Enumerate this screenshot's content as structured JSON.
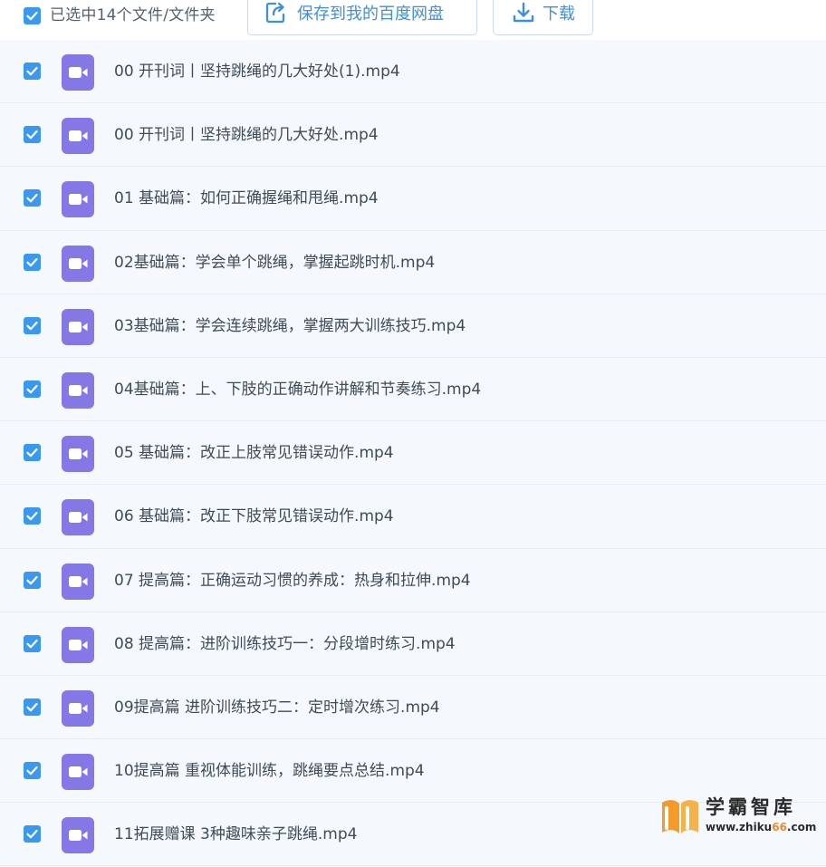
{
  "toolbar": {
    "selection_text": "已选中14个文件/文件夹",
    "save_label": "保存到我的百度网盘",
    "download_label": "下载"
  },
  "colors": {
    "accent": "#3b98f0",
    "row_background": "#f5f9fd",
    "video_icon": "#8378e6",
    "watermark_orange": "#f0892a"
  },
  "icons": {
    "checkbox": "check-icon",
    "file": "video-file-icon",
    "save": "save-to-cloud-icon",
    "download": "download-icon"
  },
  "files": [
    {
      "name": "00 开刊词丨坚持跳绳的几大好处(1).mp4",
      "checked": true
    },
    {
      "name": "00 开刊词丨坚持跳绳的几大好处.mp4",
      "checked": true
    },
    {
      "name": "01 基础篇：如何正确握绳和甩绳.mp4",
      "checked": true
    },
    {
      "name": "02基础篇：学会单个跳绳，掌握起跳时机.mp4",
      "checked": true
    },
    {
      "name": "03基础篇：学会连续跳绳，掌握两大训练技巧.mp4",
      "checked": true
    },
    {
      "name": "04基础篇：上、下肢的正确动作讲解和节奏练习.mp4",
      "checked": true
    },
    {
      "name": "05 基础篇：改正上肢常见错误动作.mp4",
      "checked": true
    },
    {
      "name": "06 基础篇：改正下肢常见错误动作.mp4",
      "checked": true
    },
    {
      "name": "07 提高篇：正确运动习惯的养成：热身和拉伸.mp4",
      "checked": true
    },
    {
      "name": "08 提高篇：进阶训练技巧一：分段增时练习.mp4",
      "checked": true
    },
    {
      "name": "09提高篇 进阶训练技巧二：定时增次练习.mp4",
      "checked": true
    },
    {
      "name": "10提高篇 重视体能训练，跳绳要点总结.mp4",
      "checked": true
    },
    {
      "name": "11拓展赠课 3种趣味亲子跳绳.mp4",
      "checked": true
    }
  ],
  "watermark": {
    "title": "学霸智库",
    "url_prefix": "www.zhiku",
    "url_highlight": "66",
    "url_suffix": ".com"
  }
}
